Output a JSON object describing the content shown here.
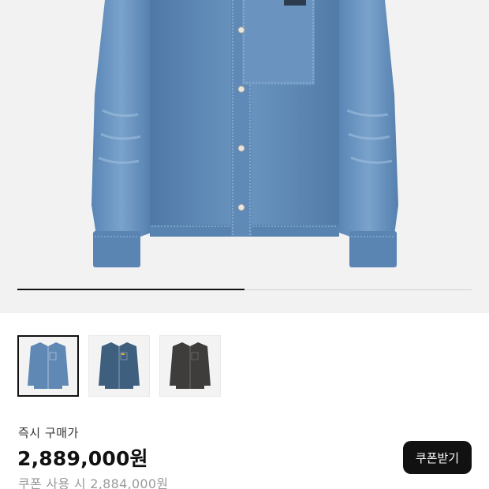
{
  "gallery": {
    "progress": 0.5,
    "thumbnails": [
      {
        "name": "light-blue-denim",
        "color": "#5f88b4",
        "selected": true
      },
      {
        "name": "dark-blue-denim",
        "color": "#3f5f7e",
        "selected": false
      },
      {
        "name": "black-denim",
        "color": "#3f3d3b",
        "selected": false
      }
    ]
  },
  "purchase": {
    "label": "즉시 구매가",
    "price": "2,889,000원",
    "coupon_price": "쿠폰 사용 시 2,884,000원",
    "coupon_button": "쿠폰받기"
  },
  "colors": {
    "hero_background": "#f2f2f2",
    "denim": "#5b83b0",
    "button_background": "#111111"
  }
}
